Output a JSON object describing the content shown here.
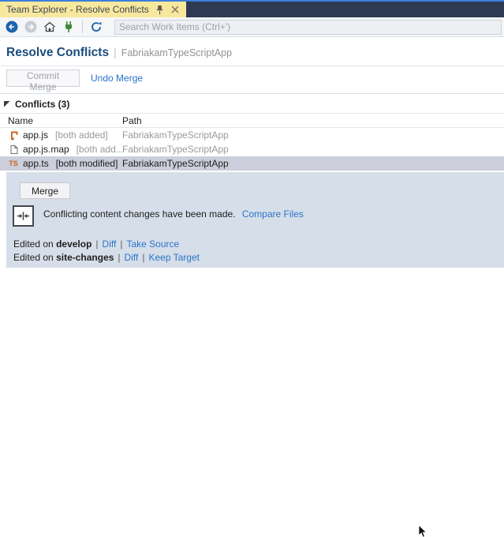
{
  "window": {
    "tab_title": "Team Explorer - Resolve Conflicts"
  },
  "toolbar": {
    "search_placeholder": "Search Work Items (Ctrl+')"
  },
  "chars": {
    "pipe": "|"
  },
  "header": {
    "title": "Resolve Conflicts",
    "project": "FabriakamTypeScriptApp"
  },
  "actions": {
    "commit_label": "Commit Merge",
    "undo_label": "Undo Merge"
  },
  "conflicts_section": {
    "title": "Conflicts (3)"
  },
  "table": {
    "columns": {
      "name": "Name",
      "path": "Path"
    },
    "rows": [
      {
        "icon": "js-file-icon",
        "name": "app.js",
        "status": "[both added]",
        "path": "FabriakamTypeScriptApp",
        "selected": false
      },
      {
        "icon": "map-file-icon",
        "name": "app.js.map",
        "status": "[both add...",
        "path": "FabriakamTypeScriptApp",
        "selected": false
      },
      {
        "icon": "ts-file-icon",
        "icon_text": "TS",
        "name": "app.ts",
        "status": "[both modified]",
        "path": "FabriakamTypeScriptApp",
        "selected": true
      }
    ]
  },
  "detail": {
    "merge_button": "Merge",
    "message": "Conflicting content changes have been made.",
    "compare_link": "Compare Files",
    "source": {
      "prefix": "Edited on",
      "branch": "develop",
      "diff": "Diff",
      "action": "Take Source"
    },
    "target": {
      "prefix": "Edited on",
      "branch": "site-changes",
      "diff": "Diff",
      "action": "Keep Target"
    }
  },
  "colors": {
    "accent_blue": "#1e63ad",
    "link_blue": "#2a74c9",
    "tab_gold": "#f7e89e",
    "titlebar_navy": "#2d3a52",
    "selection_gray": "#cccedb",
    "panel_blue": "#d6dee9",
    "file_orange": "#c8641c",
    "plug_green": "#3e8a3e"
  }
}
